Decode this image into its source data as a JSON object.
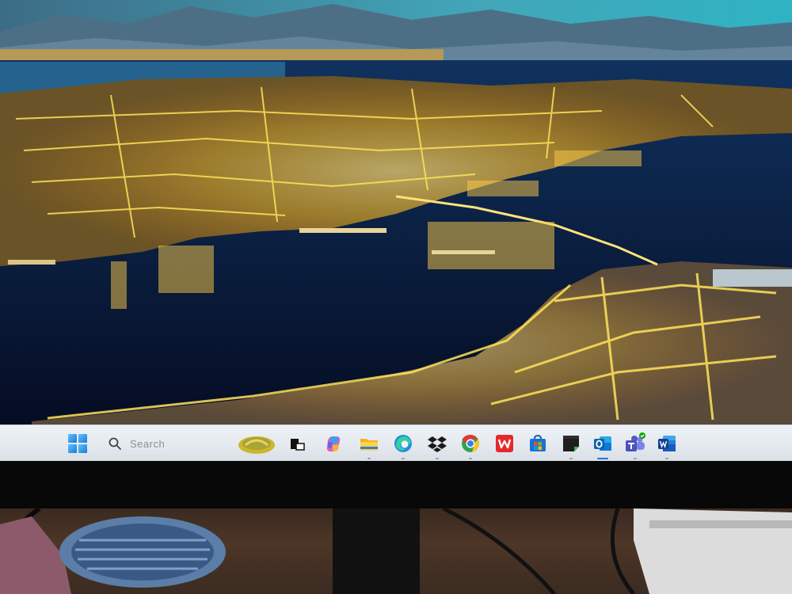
{
  "taskbar": {
    "search_placeholder": "Search",
    "apps": [
      {
        "name": "widgets-icon"
      },
      {
        "name": "task-view-icon"
      },
      {
        "name": "copilot-icon"
      },
      {
        "name": "file-explorer-icon"
      },
      {
        "name": "edge-icon"
      },
      {
        "name": "dropbox-icon"
      },
      {
        "name": "chrome-icon"
      },
      {
        "name": "wps-office-icon"
      },
      {
        "name": "microsoft-store-icon"
      },
      {
        "name": "sticky-notes-icon"
      },
      {
        "name": "outlook-icon"
      },
      {
        "name": "teams-icon"
      },
      {
        "name": "word-icon"
      }
    ]
  },
  "colors": {
    "taskbar_bg": "#e8ecf1",
    "accent": "#1b79d6",
    "city_lights": "#ffd84a",
    "water": "#0a1f4a",
    "sky": "#5ec9d6"
  }
}
